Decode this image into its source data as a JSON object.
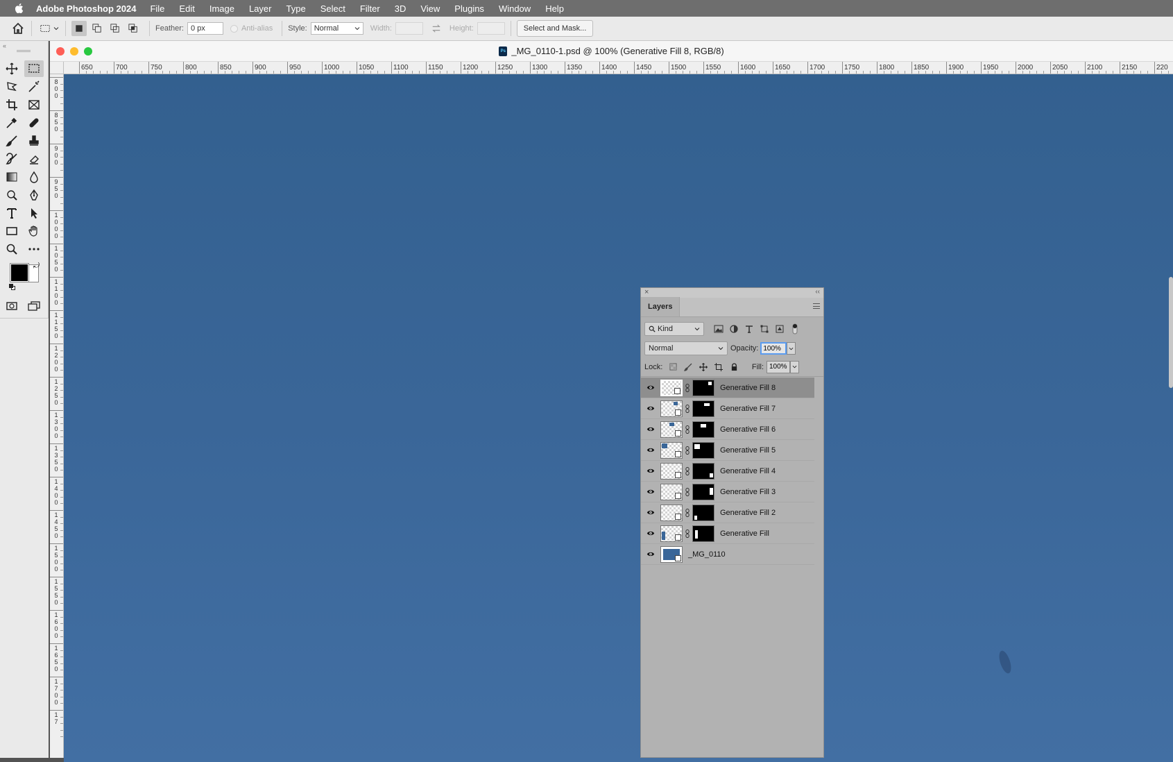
{
  "menubar": {
    "app_name": "Adobe Photoshop 2024",
    "items": [
      "File",
      "Edit",
      "Image",
      "Layer",
      "Type",
      "Select",
      "Filter",
      "3D",
      "View",
      "Plugins",
      "Window",
      "Help"
    ]
  },
  "options": {
    "feather_label": "Feather:",
    "feather_value": "0 px",
    "antialias_label": "Anti-alias",
    "style_label": "Style:",
    "style_value": "Normal",
    "width_label": "Width:",
    "height_label": "Height:",
    "select_mask_label": "Select and Mask..."
  },
  "document": {
    "title": "_MG_0110-1.psd @ 100% (Generative Fill 8, RGB/8)"
  },
  "ruler": {
    "top_labels": [
      "650",
      "700",
      "750",
      "800",
      "850",
      "900",
      "950",
      "1000",
      "1050",
      "1100",
      "1150",
      "1200",
      "1250",
      "1300",
      "1350",
      "1400",
      "1450",
      "1500",
      "1550",
      "1600",
      "1650",
      "1700",
      "1750",
      "1800",
      "1850",
      "1900",
      "1950",
      "2000",
      "2050",
      "2100",
      "2150",
      "220"
    ],
    "left_labels": [
      [
        "8",
        "0",
        "0"
      ],
      [
        "8",
        "5",
        "0"
      ],
      [
        "9",
        "0",
        "0"
      ],
      [
        "9",
        "5",
        "0"
      ],
      [
        "1",
        "0",
        "0",
        "0"
      ],
      [
        "1",
        "0",
        "5",
        "0"
      ],
      [
        "1",
        "1",
        "0",
        "0"
      ],
      [
        "1",
        "1",
        "5",
        "0"
      ],
      [
        "1",
        "2",
        "0",
        "0"
      ],
      [
        "1",
        "2",
        "5",
        "0"
      ],
      [
        "1",
        "3",
        "0",
        "0"
      ],
      [
        "1",
        "3",
        "5",
        "0"
      ],
      [
        "1",
        "4",
        "0",
        "0"
      ],
      [
        "1",
        "4",
        "5",
        "0"
      ],
      [
        "1",
        "5",
        "0",
        "0"
      ],
      [
        "1",
        "5",
        "5",
        "0"
      ],
      [
        "1",
        "6",
        "0",
        "0"
      ],
      [
        "1",
        "6",
        "5",
        "0"
      ],
      [
        "1",
        "7",
        "0",
        "0"
      ],
      [
        "1",
        "7"
      ]
    ]
  },
  "layers_panel": {
    "tab_label": "Layers",
    "kind_label": "Kind",
    "blend_mode": "Normal",
    "opacity_label": "Opacity:",
    "opacity_value": "100%",
    "lock_label": "Lock:",
    "fill_label": "Fill:",
    "fill_value": "100%",
    "layers": [
      {
        "name": "Generative Fill 8",
        "selected": true
      },
      {
        "name": "Generative Fill 7",
        "selected": false
      },
      {
        "name": "Generative Fill 6",
        "selected": false
      },
      {
        "name": "Generative Fill 5",
        "selected": false
      },
      {
        "name": "Generative Fill 4",
        "selected": false
      },
      {
        "name": "Generative Fill 3",
        "selected": false
      },
      {
        "name": "Generative Fill 2",
        "selected": false
      },
      {
        "name": "Generative Fill",
        "selected": false
      },
      {
        "name": "_MG_0110",
        "selected": false
      }
    ]
  },
  "colors": {
    "canvas_blue": "#3a6698",
    "foreground": "#000000",
    "background": "#ffffff"
  }
}
